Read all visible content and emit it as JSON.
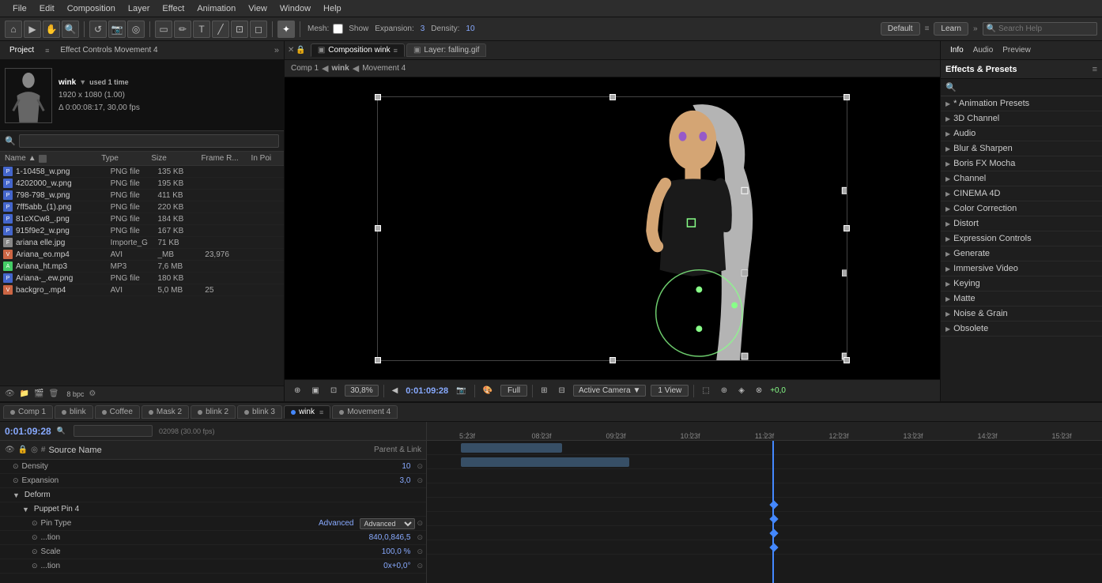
{
  "menu": {
    "items": [
      "File",
      "Edit",
      "Composition",
      "Layer",
      "Effect",
      "Animation",
      "View",
      "Window",
      "Help"
    ]
  },
  "toolbar": {
    "mesh_label": "Mesh:",
    "show_label": "Show",
    "expansion_label": "Expansion:",
    "expansion_value": "3",
    "density_label": "Density:",
    "density_value": "10",
    "workspace": "Default",
    "learn": "Learn",
    "search_placeholder": "Search Help"
  },
  "project_panel": {
    "title": "Project",
    "effect_controls": "Effect Controls  Movement 4",
    "preview_name": "wink",
    "preview_used": "used 1 time",
    "preview_res": "1920 x 1080 (1.00)",
    "preview_duration": "Δ 0:00:08:17, 30,00 fps",
    "columns": {
      "name": "Name",
      "type": "Type",
      "size": "Size",
      "frame_rate": "Frame R...",
      "in_point": "In Poi"
    },
    "files": [
      {
        "name": "1-10458_w.png",
        "type": "PNG file",
        "size": "135 KB",
        "frame": "",
        "inpo": ""
      },
      {
        "name": "4202000_w.png",
        "type": "PNG file",
        "size": "195 KB",
        "frame": "",
        "inpo": ""
      },
      {
        "name": "798-798_w.png",
        "type": "PNG file",
        "size": "411 KB",
        "frame": "",
        "inpo": ""
      },
      {
        "name": "7ff5abb_(1).png",
        "type": "PNG file",
        "size": "220 KB",
        "frame": "",
        "inpo": ""
      },
      {
        "name": "81cXCw8_.png",
        "type": "PNG file",
        "size": "184 KB",
        "frame": "",
        "inpo": ""
      },
      {
        "name": "915f9e2_w.png",
        "type": "PNG file",
        "size": "167 KB",
        "frame": "",
        "inpo": ""
      },
      {
        "name": "ariana elle.jpg",
        "type": "Importe_G",
        "size": "71 KB",
        "frame": "",
        "inpo": ""
      },
      {
        "name": "Ariana_eo.mp4",
        "type": "AVI",
        "size": "_MB",
        "frame": "23,976",
        "inpo": ""
      },
      {
        "name": "Ariana_ht.mp3",
        "type": "MP3",
        "size": "7,6 MB",
        "frame": "",
        "inpo": ""
      },
      {
        "name": "Ariana-_.ew.png",
        "type": "PNG file",
        "size": "180 KB",
        "frame": "",
        "inpo": ""
      },
      {
        "name": "backgro_.mp4",
        "type": "AVI",
        "size": "5,0 MB",
        "frame": "25",
        "inpo": ""
      }
    ]
  },
  "viewer": {
    "tabs": [
      {
        "label": "Composition wink",
        "active": true,
        "closable": true
      },
      {
        "label": "Layer: falling.gif",
        "active": false,
        "closable": false
      }
    ],
    "breadcrumb": [
      "Comp 1",
      "wink",
      "Movement 4"
    ],
    "timecode": "0:01:09:28",
    "zoom": "30,8%",
    "quality": "Full",
    "camera": "Active Camera",
    "view": "1 View",
    "plus_offset": "+0,0"
  },
  "right_panel": {
    "tabs": [
      "Info",
      "Audio",
      "Preview"
    ],
    "effects_title": "Effects & Presets",
    "effects_groups": [
      {
        "label": "* Animation Presets",
        "star": true
      },
      {
        "label": "3D Channel"
      },
      {
        "label": "Audio"
      },
      {
        "label": "Blur & Sharpen"
      },
      {
        "label": "Boris FX Mocha"
      },
      {
        "label": "Channel"
      },
      {
        "label": "CINEMA 4D"
      },
      {
        "label": "Color Correction"
      },
      {
        "label": "Distort"
      },
      {
        "label": "Expression Controls"
      },
      {
        "label": "Generate"
      },
      {
        "label": "Immersive Video"
      },
      {
        "label": "Keying"
      },
      {
        "label": "Matte"
      },
      {
        "label": "Noise & Grain"
      },
      {
        "label": "Obsolete"
      }
    ]
  },
  "timeline": {
    "tabs": [
      {
        "label": "Comp 1",
        "color": "#888",
        "active": false
      },
      {
        "label": "blink",
        "color": "#888",
        "active": false
      },
      {
        "label": "Coffee",
        "color": "#888",
        "active": false
      },
      {
        "label": "Mask 2",
        "color": "#888",
        "active": false
      },
      {
        "label": "blink 2",
        "color": "#888",
        "active": false
      },
      {
        "label": "blink 3",
        "color": "#888",
        "active": false
      },
      {
        "label": "wink",
        "color": "#4488ff",
        "active": true
      },
      {
        "label": "Movement 4",
        "color": "#888",
        "active": false
      }
    ],
    "timecode": "0:01:09:28",
    "fps": "02098 (30.00 fps)",
    "ruler_marks": [
      "5:23f",
      "08:23f",
      "09:23f",
      "10:23f",
      "11:23f",
      "12:23f",
      "13:23f",
      "14:23f",
      "15:23f"
    ],
    "layers": [
      {
        "type": "prop",
        "indent": 1,
        "label": "Density",
        "value": "10"
      },
      {
        "type": "prop",
        "indent": 1,
        "label": "Expansion",
        "value": "3,0"
      },
      {
        "type": "group",
        "indent": 1,
        "label": "Deform"
      },
      {
        "type": "group",
        "indent": 2,
        "label": "Puppet Pin 4"
      },
      {
        "type": "prop",
        "indent": 3,
        "label": "Pin Type",
        "value": "Advanced"
      },
      {
        "type": "prop",
        "indent": 3,
        "label": "...tion",
        "value": "840,0,846,5"
      },
      {
        "type": "prop",
        "indent": 3,
        "label": "Scale",
        "value": "100,0 %"
      },
      {
        "type": "prop",
        "indent": 3,
        "label": "...tion",
        "value": "0x+0,0°"
      }
    ]
  }
}
